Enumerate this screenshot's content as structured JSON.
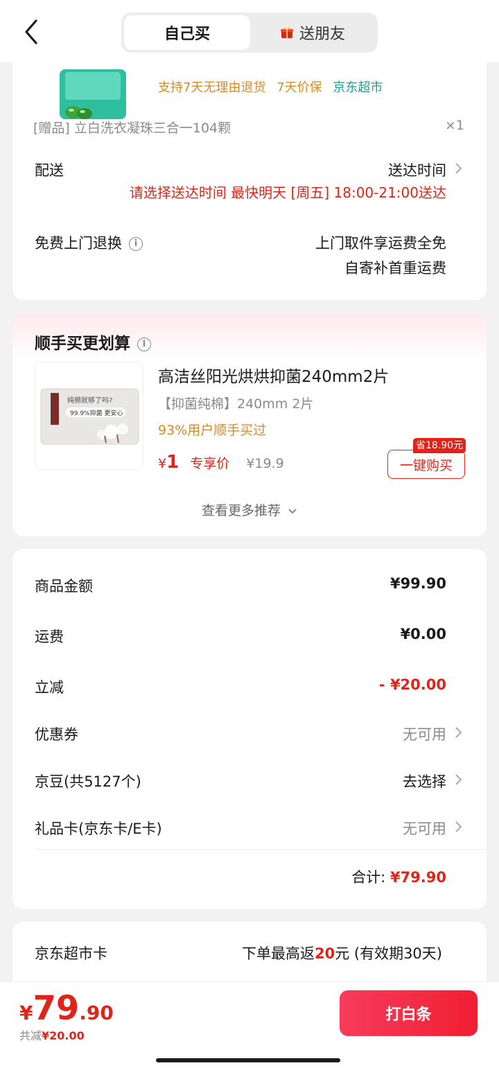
{
  "header": {
    "tab_self": "自己买",
    "tab_gift": "送朋友"
  },
  "order": {
    "badges": [
      "支持7天无理由退货",
      "7天价保",
      "京东超市"
    ],
    "gift_line": "[赠品]   立白洗衣凝珠三合一104颗",
    "gift_qty": "×1",
    "delivery_label": "配送",
    "delivery_time_label": "送达时间",
    "delivery_note": "请选择送达时间   最快明天 [周五] 18:00-21:00送达",
    "return_label": "免费上门退换",
    "return_line1": "上门取件享运费全免",
    "return_line2": "自寄补首重运费"
  },
  "recommend": {
    "title": "顺手买更划算",
    "image_caption": "纯棉就够了吗?",
    "image_badge": "99.9%抑菌 更安心",
    "name": "高洁丝阳光烘烘抑菌240mm2片",
    "spec": "【抑菌纯棉】240mm 2片",
    "users": "93%用户顺手买过",
    "price_symbol": "¥",
    "price": "1",
    "price_label": "专享价",
    "orig_price": "¥19.9",
    "save_tag": "省18.90元",
    "buy_button": "一键购买",
    "more": "查看更多推荐"
  },
  "summary": {
    "rows": [
      {
        "label": "商品金额",
        "value": "¥99.90"
      },
      {
        "label": "运费",
        "value": "¥0.00"
      },
      {
        "label": "立减",
        "value": "- ¥20.00"
      },
      {
        "label": "优惠券",
        "value": "无可用"
      },
      {
        "label": "京豆(共5127个)",
        "value": "去选择"
      },
      {
        "label": "礼品卡(京东卡/E卡)",
        "value": "无可用"
      }
    ],
    "total_label": "合计:",
    "total_value": "¥79.90"
  },
  "card": {
    "label": "京东超市卡",
    "text_prefix": "下单最高返",
    "text_highlight": "20",
    "text_suffix": "元 (有效期30天)"
  },
  "footer": {
    "price_symbol": "¥",
    "price_int": "79",
    "price_dec": ".90",
    "save_label": "共减",
    "save_value": "¥20.00",
    "pay_button": "打白条"
  },
  "colors": {
    "accent_red": "#e2231a",
    "orange": "#d88a25",
    "green": "#1aa383"
  }
}
